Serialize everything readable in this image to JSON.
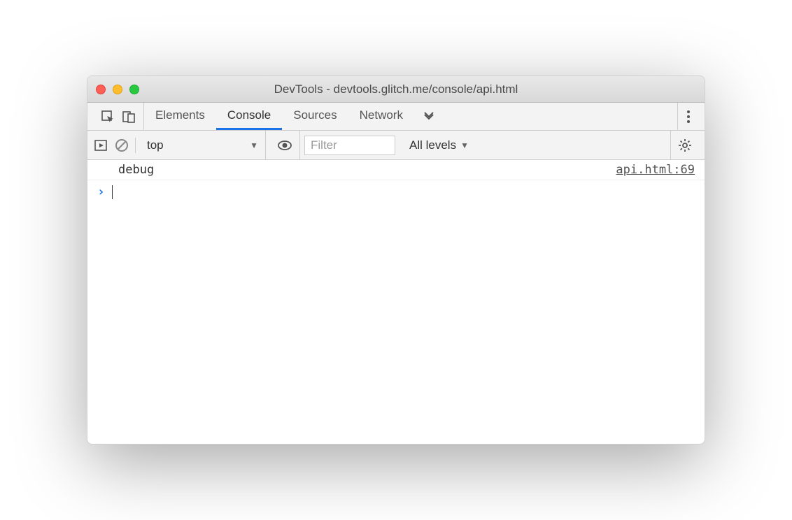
{
  "window": {
    "title": "DevTools - devtools.glitch.me/console/api.html"
  },
  "tabs": {
    "items": [
      "Elements",
      "Console",
      "Sources",
      "Network"
    ],
    "active_index": 1
  },
  "console_toolbar": {
    "context": "top",
    "filter_placeholder": "Filter",
    "levels_label": "All levels"
  },
  "console_logs": [
    {
      "message": "debug",
      "source": "api.html:69"
    }
  ],
  "prompt": {
    "symbol": "›"
  }
}
